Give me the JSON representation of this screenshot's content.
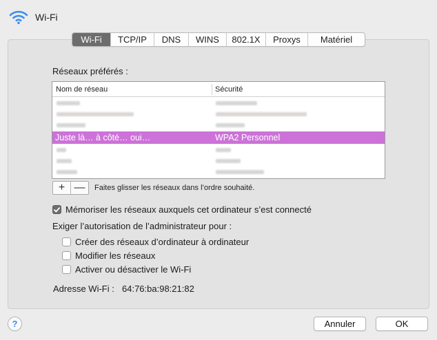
{
  "window": {
    "title": "Wi-Fi",
    "icons": {
      "header": "wifi-icon",
      "help": "question-mark-icon"
    },
    "colors": {
      "selected_row": "#cc72d8",
      "selected_tab": "#6d6d6d"
    }
  },
  "tabs": [
    {
      "label": "Wi-Fi",
      "selected": true
    },
    {
      "label": "TCP/IP"
    },
    {
      "label": "DNS"
    },
    {
      "label": "WINS"
    },
    {
      "label": "802.1X"
    },
    {
      "label": "Proxys"
    },
    {
      "label": "Matériel"
    }
  ],
  "preferred": {
    "label": "Réseaux préférés :",
    "columns": [
      "Nom de réseau",
      "Sécurité"
    ],
    "selected_row": {
      "name": "Juste là… à côté… oui…",
      "security": "WPA2 Personnel"
    }
  },
  "list_controls": {
    "add": "+",
    "remove": "—",
    "hint": "Faites glisser les réseaux dans l’ordre souhaité."
  },
  "remember": {
    "label": "Mémoriser les réseaux auxquels cet ordinateur s’est connecté",
    "checked": true
  },
  "admin": {
    "label": "Exiger l’autorisation de l’administrateur pour :",
    "options": [
      {
        "label": "Créer des réseaux d’ordinateur à ordinateur",
        "checked": false
      },
      {
        "label": "Modifier les réseaux",
        "checked": false
      },
      {
        "label": "Activer ou désactiver le Wi-Fi",
        "checked": false
      }
    ]
  },
  "address": {
    "label": "Adresse Wi-Fi :",
    "value": "64:76:ba:98:21:82"
  },
  "buttons": {
    "cancel": "Annuler",
    "ok": "OK",
    "help": "?"
  }
}
